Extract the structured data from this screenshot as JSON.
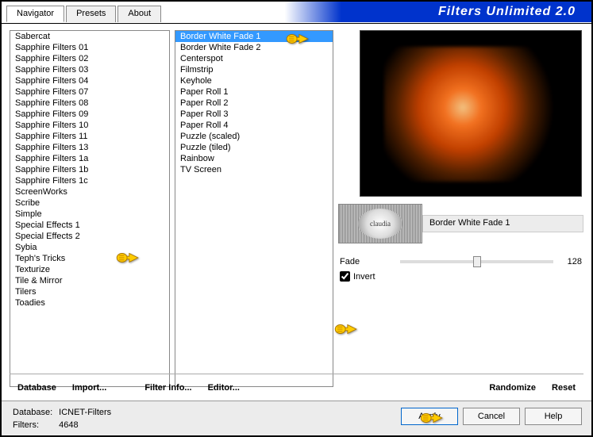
{
  "header": {
    "title": "Filters Unlimited 2.0"
  },
  "tabs": [
    "Navigator",
    "Presets",
    "About"
  ],
  "active_tab": 0,
  "categories": [
    "Sabercat",
    "Sapphire Filters 01",
    "Sapphire Filters 02",
    "Sapphire Filters 03",
    "Sapphire Filters 04",
    "Sapphire Filters 07",
    "Sapphire Filters 08",
    "Sapphire Filters 09",
    "Sapphire Filters 10",
    "Sapphire Filters 11",
    "Sapphire Filters 13",
    "Sapphire Filters 1a",
    "Sapphire Filters 1b",
    "Sapphire Filters 1c",
    "ScreenWorks",
    "Scribe",
    "Simple",
    "Special Effects 1",
    "Special Effects 2",
    "Sybia",
    "Teph's Tricks",
    "Texturize",
    "Tile & Mirror",
    "Tilers",
    "Toadies"
  ],
  "selected_category": "Special Effects 2",
  "filters": [
    "Border White Fade 1",
    "Border White Fade 2",
    "Centerspot",
    "Filmstrip",
    "Keyhole",
    "Paper Roll 1",
    "Paper Roll 2",
    "Paper Roll 3",
    "Paper Roll 4",
    "Puzzle (scaled)",
    "Puzzle (tiled)",
    "Rainbow",
    "TV Screen"
  ],
  "selected_filter": "Border White Fade 1",
  "filter_title": "Border White Fade 1",
  "stamp_label": "claudia",
  "params": {
    "fade": {
      "label": "Fade",
      "value": 128
    },
    "invert": {
      "label": "Invert",
      "checked": true
    }
  },
  "buttons": {
    "database": "Database",
    "import": "Import...",
    "filter_info": "Filter Info...",
    "editor": "Editor...",
    "randomize": "Randomize",
    "reset": "Reset"
  },
  "footer": {
    "db_label": "Database:",
    "db_value": "ICNET-Filters",
    "filters_label": "Filters:",
    "filters_value": "4648",
    "apply": "Apply",
    "cancel": "Cancel",
    "help": "Help"
  }
}
